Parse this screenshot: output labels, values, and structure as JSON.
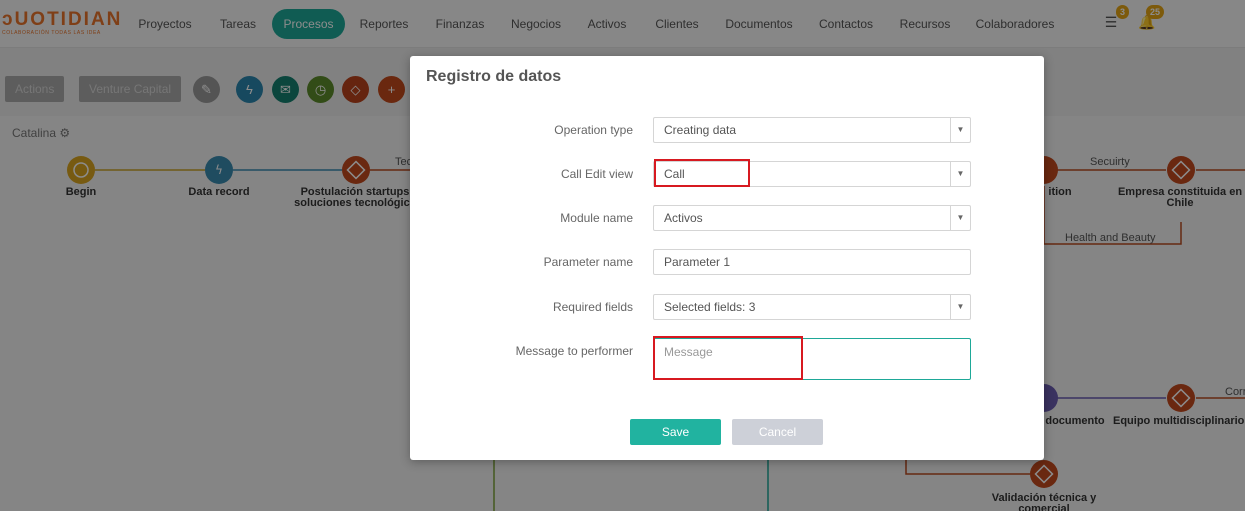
{
  "app": {
    "logo_text": "ᴐUOTIDIAN",
    "logo_tagline": "COLABORACIÓN TODAS LAS IDEA"
  },
  "nav": {
    "items": [
      "Proyectos",
      "Tareas",
      "Procesos",
      "Reportes",
      "Finanzas",
      "Negocios",
      "Activos",
      "Clientes",
      "Documentos",
      "Contactos",
      "Recursos",
      "Colaboradores"
    ],
    "active": "Procesos",
    "list_badge": "3",
    "bell_badge": "25"
  },
  "toolbar": {
    "actions_label": "Actions",
    "context_label": "Venture Capital",
    "icons": [
      "pencil-icon",
      "bolt-icon",
      "envelope-icon",
      "clock-icon",
      "diamond-icon",
      "plus-icon"
    ]
  },
  "canvas": {
    "title": "Catalina",
    "nodes": {
      "begin": "Begin",
      "data_record": "Data record",
      "postulacion": "Postulación startups\nsoluciones tecnológica",
      "acquisition_partial": "ition",
      "empresa": "Empresa constituida en\nChile",
      "documento_partial": "documento",
      "equipo": "Equipo multidisciplinario",
      "validacion": "Validación técnica y\ncomercial"
    },
    "edges": {
      "tec_partial": "Tec",
      "security": "Secuirty",
      "health": "Health and Beauty",
      "corr_partial": "Corr"
    }
  },
  "modal": {
    "title": "Registro de datos",
    "fields": {
      "operation_type": {
        "label": "Operation type",
        "value": "Creating data"
      },
      "call_edit_view": {
        "label": "Call Edit view",
        "value": "Call"
      },
      "module_name": {
        "label": "Module name",
        "value": "Activos"
      },
      "parameter_name": {
        "label": "Parameter name",
        "value": "Parameter 1"
      },
      "required_fields": {
        "label": "Required fields",
        "value": "Selected fields: 3"
      },
      "message": {
        "label": "Message to performer",
        "placeholder": "Message",
        "value": ""
      }
    },
    "save_label": "Save",
    "cancel_label": "Cancel"
  },
  "colors": {
    "accent": "#1ea898",
    "brand": "#e8732a",
    "highlight": "#d71920",
    "save": "#21b3a0",
    "cancel": "#cdd0d8"
  }
}
